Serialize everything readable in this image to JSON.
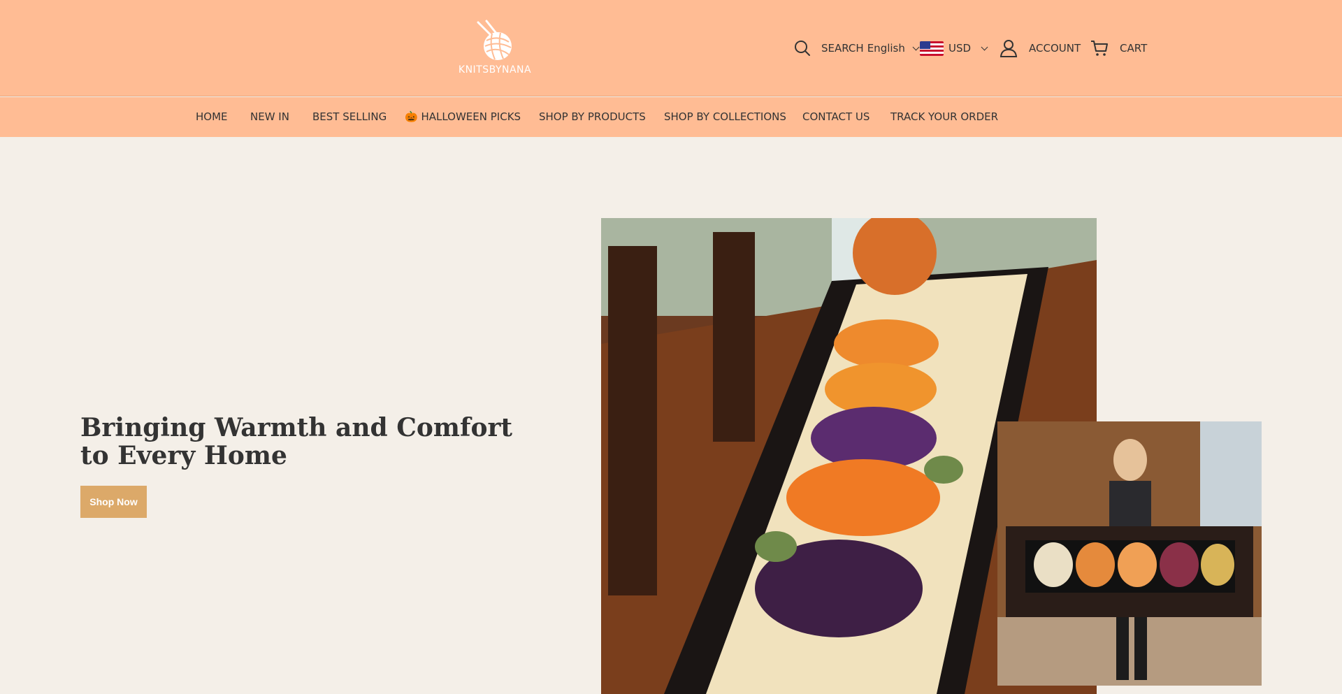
{
  "brand": {
    "name": "KNITSBYNANA",
    "logo_icon": "yarn-ball-with-needles-icon"
  },
  "header": {
    "search_label": "SEARCH",
    "language": "English",
    "currency": "USD",
    "account_label": "ACCOUNT",
    "cart_label": "CART"
  },
  "nav": {
    "items": [
      {
        "label": "HOME"
      },
      {
        "label": "NEW IN"
      },
      {
        "label": "BEST SELLING"
      },
      {
        "label": "🎃 HALLOWEEN PICKS"
      },
      {
        "label": "SHOP BY PRODUCTS"
      },
      {
        "label": "SHOP BY COLLECTIONS"
      },
      {
        "label": "CONTACT US"
      },
      {
        "label": "TRACK YOUR ORDER"
      }
    ]
  },
  "hero": {
    "title": "Bringing Warmth and Comfort to Every Home",
    "cta_label": "Shop Now"
  },
  "colors": {
    "header_bg": "#ffbc94",
    "page_bg": "#f4efe8",
    "button_bg": "#dca969"
  }
}
